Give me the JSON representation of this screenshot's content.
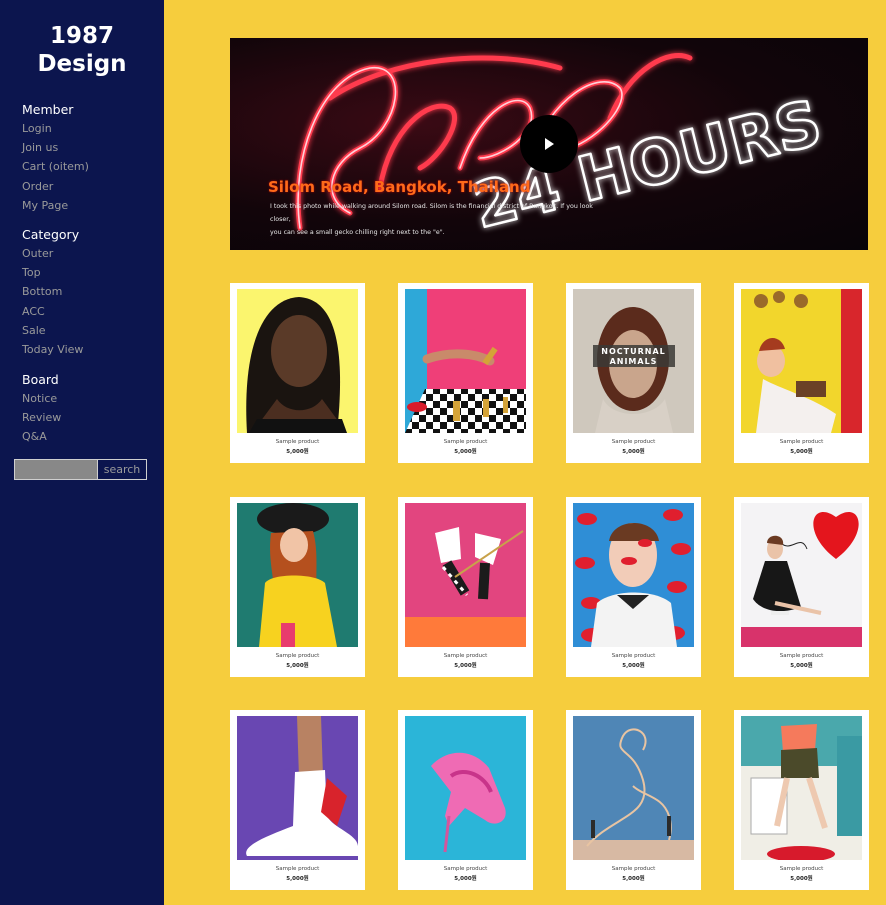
{
  "brand": {
    "line1": "1987",
    "line2": "Design"
  },
  "menu": [
    {
      "title": "Member",
      "items": [
        "Login",
        "Join us",
        "Cart (oitem)",
        "Order",
        "My Page"
      ]
    },
    {
      "title": "Category",
      "items": [
        "Outer",
        "Top",
        "Bottom",
        "ACC",
        "Sale",
        "Today View"
      ]
    },
    {
      "title": "Board",
      "items": [
        "Notice",
        "Review",
        "Q&A"
      ]
    }
  ],
  "search": {
    "button_label": "search",
    "value": ""
  },
  "hero": {
    "caption_title": "Silom Road, Bangkok, Thailand",
    "caption_line1": "I took this photo while walking around Silom road. Silom is the financial district of Bangkok. If you look closer,",
    "caption_line2": "you can see a small gecko chilling right next to the \"e\".",
    "neon_text": "24 HOURS",
    "play_icon": "play-icon"
  },
  "poster": {
    "title": "NOCTURNAL",
    "title2": "ANIMALS"
  },
  "products": [
    {
      "name": "Sample product",
      "price": "5,000원",
      "image": "woman-portrait-yellow"
    },
    {
      "name": "Sample product",
      "price": "5,000원",
      "image": "lipstick-checkerboard"
    },
    {
      "name": "Sample product",
      "price": "5,000원",
      "image": "nocturnal-animals-poster"
    },
    {
      "name": "Sample product",
      "price": "5,000원",
      "image": "woman-yellow-kitchen"
    },
    {
      "name": "Sample product",
      "price": "5,000원",
      "image": "woman-yellow-coat"
    },
    {
      "name": "Sample product",
      "price": "5,000원",
      "image": "platform-sandals-pink"
    },
    {
      "name": "Sample product",
      "price": "5,000원",
      "image": "lips-pattern-woman"
    },
    {
      "name": "Sample product",
      "price": "5,000원",
      "image": "woman-red-heart"
    },
    {
      "name": "Sample product",
      "price": "5,000원",
      "image": "white-sock-purple"
    },
    {
      "name": "Sample product",
      "price": "5,000원",
      "image": "pink-slipper-blue"
    },
    {
      "name": "Sample product",
      "price": "5,000원",
      "image": "line-art-blue-wall"
    },
    {
      "name": "Sample product",
      "price": "5,000원",
      "image": "retro-kitchen-woman"
    }
  ]
}
